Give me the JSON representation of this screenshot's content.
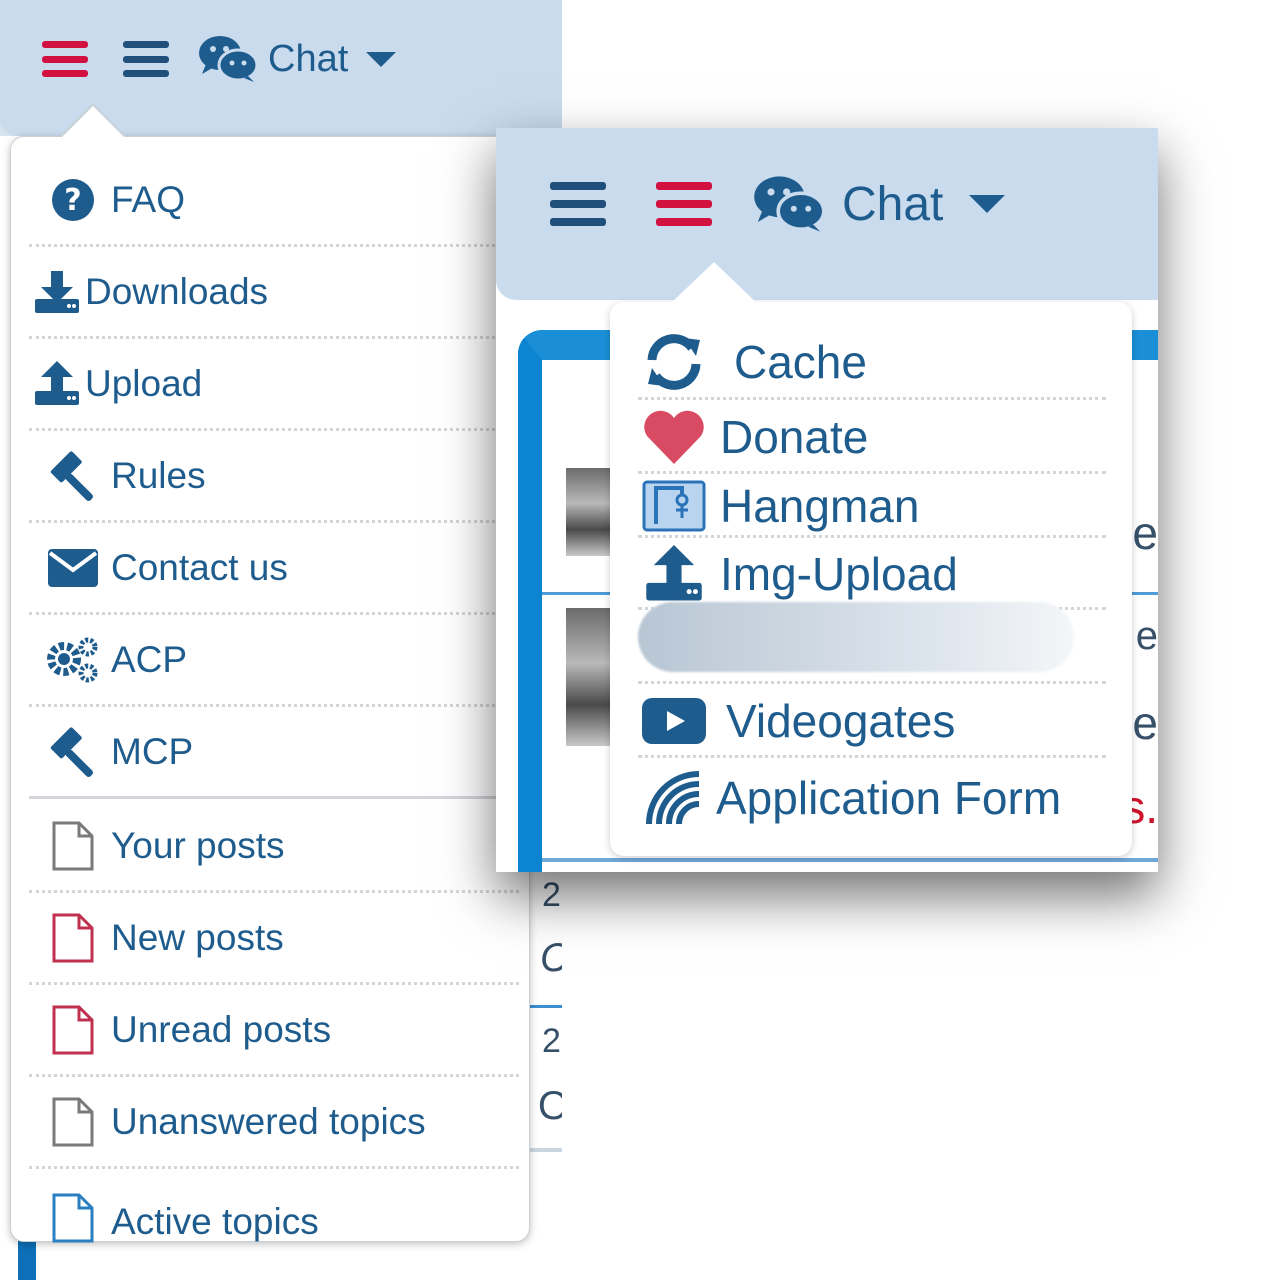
{
  "left": {
    "navbar": {
      "chat_label": "Chat"
    },
    "menu_items": [
      {
        "label": "FAQ",
        "icon": "question-circle-icon"
      },
      {
        "label": "Downloads",
        "icon": "download-icon"
      },
      {
        "label": "Upload",
        "icon": "upload-icon"
      },
      {
        "label": "Rules",
        "icon": "gavel-icon"
      },
      {
        "label": "Contact us",
        "icon": "envelope-icon"
      },
      {
        "label": "ACP",
        "icon": "gears-icon"
      },
      {
        "label": "MCP",
        "icon": "gavel-icon"
      },
      {
        "label": "Your posts",
        "icon": "file-icon"
      },
      {
        "label": "New posts",
        "icon": "file-icon"
      },
      {
        "label": "Unread posts",
        "icon": "file-icon"
      },
      {
        "label": "Unanswered topics",
        "icon": "file-icon"
      },
      {
        "label": "Active topics",
        "icon": "file-icon"
      }
    ],
    "peek": [
      "2",
      "C",
      "2",
      "O"
    ]
  },
  "right": {
    "navbar": {
      "chat_label": "Chat"
    },
    "menu_items": [
      {
        "label": "Cache",
        "icon": "refresh-icon"
      },
      {
        "label": "Donate",
        "icon": "heart-icon"
      },
      {
        "label": "Hangman",
        "icon": "hangman-icon"
      },
      {
        "label": "Img-Upload",
        "icon": "upload-icon"
      },
      {
        "label": "Videogates",
        "icon": "youtube-icon"
      },
      {
        "label": "Application Form",
        "icon": "signal-icon"
      }
    ],
    "peek": [
      "e",
      "e",
      "e",
      "s."
    ]
  },
  "colors": {
    "brand_blue": "#1f5c8e",
    "active_red": "#d31141",
    "navbar_bg": "#c9dbed"
  }
}
